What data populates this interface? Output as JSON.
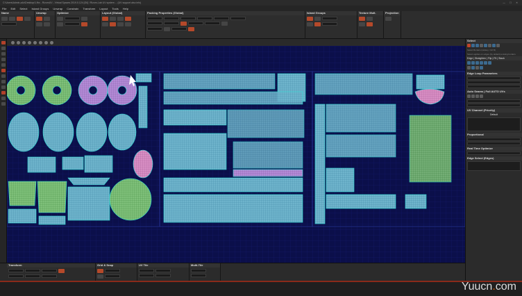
{
  "window": {
    "title": "C:\\Users\\Admin-a4c\\Desktop\\1.fbx - RizomUV - Virtual Spaces 2019.0.124 [Gil] / Rizom-Lab UV system ... (UV support also info)"
  },
  "menu": {
    "items": [
      "File",
      "Edit",
      "Select",
      "Island Groups",
      "Unwrap",
      "Constrain",
      "Transform",
      "Layout",
      "Tools",
      "Help"
    ]
  },
  "ribbon": {
    "panels": [
      {
        "title": "Name"
      },
      {
        "title": "Unwrap"
      },
      {
        "title": "Optimize"
      },
      {
        "title": "Layout (Global)"
      },
      {
        "title": "Packing Properties (Global)"
      },
      {
        "title": "Island Groups"
      },
      {
        "title": "Texture Mult."
      },
      {
        "title": "Projection"
      }
    ]
  },
  "right_panel": {
    "header": "Select",
    "tooltip_line1": "Select Borders (Hotkey: Ctrl B)",
    "tooltip_line2": "Select applies on edges (by default) existing borders",
    "edge_loop_label": "Edge | Straighten | Flip | Fit | Stack",
    "sections": [
      {
        "title": "Edge Loop Parameters"
      },
      {
        "title": "Auto Seams | Full AUTO UVs"
      },
      {
        "title": "UV Channel (Priority)"
      },
      {
        "title": "Default"
      },
      {
        "title": "Proportional"
      },
      {
        "title": "Real Time Optimize"
      },
      {
        "title": "Edge Select (Edges)"
      }
    ]
  },
  "bottom_panels": [
    {
      "title": "Transform"
    },
    {
      "title": "Grid & Snap"
    },
    {
      "title": "UV Tile"
    },
    {
      "title": "Multi-Tile"
    }
  ],
  "watermark": {
    "prefix": "Yuucn",
    "dot": ".",
    "suffix": "com"
  },
  "colors": {
    "viewport_bg": "#0b0f4a",
    "uv_fill": "#6bb0c8",
    "uv_stroke": "#2de0d8",
    "accent": "#b5492a"
  }
}
